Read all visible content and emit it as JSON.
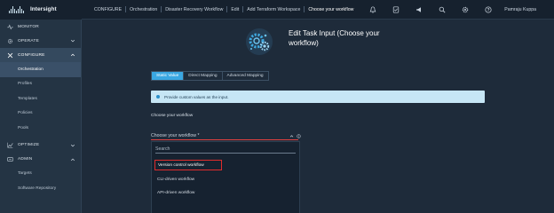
{
  "app": {
    "brand": "Intersight"
  },
  "breadcrumb": [
    "CONFIGURE",
    "Orchestration",
    "Disaster Recovery Workflow",
    "Edit",
    "Add Terraform Workspace",
    "Choose your workflow"
  ],
  "header_icons": [
    "bell-icon",
    "checklist-icon",
    "megaphone-icon",
    "search-icon",
    "settings-icon",
    "help-icon"
  ],
  "user": {
    "name": "Pamraju Kuppa"
  },
  "sidebar": {
    "monitor": "MONITOR",
    "operate": "OPERATE",
    "configure": "CONFIGURE",
    "configure_items": [
      "Orchestration",
      "Profiles",
      "Templates",
      "Policies",
      "Pools"
    ],
    "optimize": "OPTIMIZE",
    "admin": "ADMIN",
    "admin_items": [
      "Targets",
      "Software Repository"
    ]
  },
  "page": {
    "title": "Edit Task Input (Choose your workflow)",
    "tabs": [
      "Static Value",
      "Direct Mapping",
      "Advanced Mapping"
    ],
    "active_tab": "Static Value",
    "info": "Provide custom values as the input.",
    "field_label": "Choose your workflow",
    "select_placeholder": "Choose your workflow *",
    "search_placeholder": "Search",
    "options": [
      "Version control workflow",
      "CLI-driven workflow",
      "API-driven workflow"
    ],
    "highlighted_option": "Version control workflow"
  },
  "colors": {
    "accent": "#3aa7e2",
    "highlight_border": "#e02c2c",
    "info_bg": "#c6e6f5"
  }
}
